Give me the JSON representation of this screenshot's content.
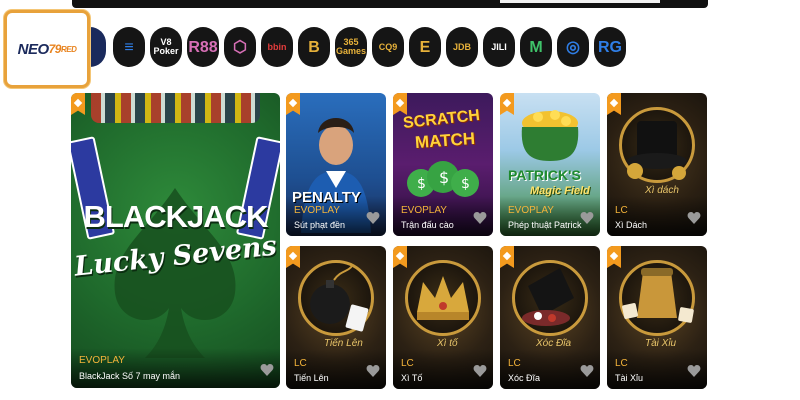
{
  "brand": {
    "logo_main": "NEO",
    "logo_num": "79",
    "logo_suffix": "RED"
  },
  "providers": [
    {
      "label": "",
      "icon": "partial-provider-icon"
    },
    {
      "label": "≡",
      "icon": "evolution-icon"
    },
    {
      "label": "V8 Poker",
      "icon": "v8-poker-icon"
    },
    {
      "label": "R88",
      "icon": "r88-icon"
    },
    {
      "label": "⬡",
      "icon": "hexagon-icon"
    },
    {
      "label": "bbin",
      "icon": "bbin-icon"
    },
    {
      "label": "B",
      "icon": "bt-icon"
    },
    {
      "label": "365 Games",
      "icon": "365-games-icon"
    },
    {
      "label": "CQ9",
      "icon": "cq9-icon"
    },
    {
      "label": "E",
      "icon": "e-provider-icon"
    },
    {
      "label": "JDB",
      "icon": "jdb-icon"
    },
    {
      "label": "JILI",
      "icon": "jili-icon"
    },
    {
      "label": "M",
      "icon": "m-provider-icon"
    },
    {
      "label": "◎",
      "icon": "swirl-provider-icon"
    },
    {
      "label": "RG",
      "icon": "rg-icon"
    }
  ],
  "games": {
    "blackjack": {
      "title": "BLACKJACK",
      "subtitle": "Lucky Sevens",
      "provider": "EVOPLAY",
      "name": "BlackJack Số 7 may mắn"
    },
    "penalty": {
      "art_text": "PENALTY",
      "provider": "EVOPLAY",
      "name": "Sút phạt đền"
    },
    "scratch": {
      "art_text_1": "SCRATCH",
      "art_text_2": "MATCH",
      "provider": "EVOPLAY",
      "name": "Trận đấu cào"
    },
    "patrick": {
      "art_text_1": "PATRICK'S",
      "art_text_2": "Magic Field",
      "provider": "EVOPLAY",
      "name": "Phép thuật Patrick"
    },
    "xidach": {
      "overlay": "Xì dách",
      "provider": "LC",
      "name": "Xì Dách"
    },
    "tienlen": {
      "overlay": "Tiến Lên",
      "provider": "LC",
      "name": "Tiến Lên"
    },
    "xito": {
      "overlay": "Xì tố",
      "provider": "LC",
      "name": "Xì Tố"
    },
    "xocdia": {
      "overlay": "Xóc Đĩa",
      "provider": "LC",
      "name": "Xóc Đĩa"
    },
    "taixiu": {
      "overlay": "Tài Xỉu",
      "provider": "LC",
      "name": "Tài Xỉu"
    }
  },
  "colors": {
    "accent": "#f39a1e",
    "provider_label": "#f4b43a",
    "logo_border": "#e8a23b"
  }
}
